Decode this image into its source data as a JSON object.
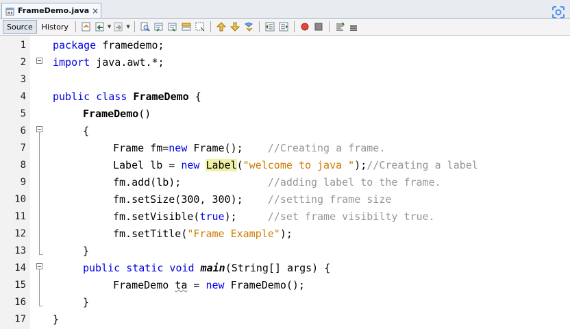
{
  "tab": {
    "title": "FrameDemo.java",
    "close": "×",
    "icon": "java-file-icon"
  },
  "toolbar": {
    "source_label": "Source",
    "history_label": "History",
    "icons": [
      "last-edit-icon",
      "back-icon",
      "forward-icon",
      "find-icon",
      "find-previous-icon",
      "find-next-icon",
      "toggle-highlight-icon",
      "toggle-rect-select-icon",
      "previous-bookmark-icon",
      "next-bookmark-icon",
      "toggle-bookmark-icon",
      "shift-left-icon",
      "shift-right-icon",
      "start-macro-icon",
      "stop-macro-icon",
      "comment-icon",
      "uncomment-icon"
    ]
  },
  "editor": {
    "line_numbers": [
      "1",
      "2",
      "3",
      "4",
      "5",
      "6",
      "7",
      "8",
      "9",
      "10",
      "11",
      "12",
      "13",
      "14",
      "15",
      "16",
      "17"
    ],
    "lines": {
      "l1": {
        "kw": "package",
        "rest": " framedemo;"
      },
      "l2": {
        "kw": "import",
        "rest": " java.awt.*;"
      },
      "l4": {
        "kw": "public class",
        "name": "FrameDemo",
        "rest": " {"
      },
      "l5": {
        "name": "FrameDemo",
        "rest": "()"
      },
      "l6": {
        "text": "{"
      },
      "l7": {
        "a": "Frame fm=",
        "kw": "new",
        "b": " Frame();    ",
        "comment": "//Creating a frame."
      },
      "l8": {
        "a": "Label lb = ",
        "kw": "new",
        "hl": "Label",
        "b": "(",
        "str": "\"welcome to java \"",
        "c": ");",
        "comment": "//Creating a label"
      },
      "l9": {
        "a": "fm.add(lb);              ",
        "comment": "//adding label to the frame."
      },
      "l10": {
        "a": "fm.setSize(300, 300);    ",
        "comment": "//setting frame size"
      },
      "l11": {
        "a": "fm.setVisible(",
        "kw": "true",
        "b": ");     ",
        "comment": "//set frame visibilty true."
      },
      "l12": {
        "a": "fm.setTitle(",
        "str": "\"Frame Example\"",
        "b": ");"
      },
      "l13": {
        "text": "}"
      },
      "l14": {
        "kw": "public static void",
        "method": "main",
        "rest": "(String[] args) {"
      },
      "l15": {
        "a": "FrameDemo ",
        "var": "ta",
        "b": " = ",
        "kw": "new",
        "c": " FrameDemo();"
      },
      "l16": {
        "text": "}"
      },
      "l17": {
        "text": "}"
      }
    }
  },
  "colors": {
    "keyword": "#0000e6",
    "string": "#ce7b00",
    "comment": "#969696",
    "highlight": "#f0f0a6"
  }
}
